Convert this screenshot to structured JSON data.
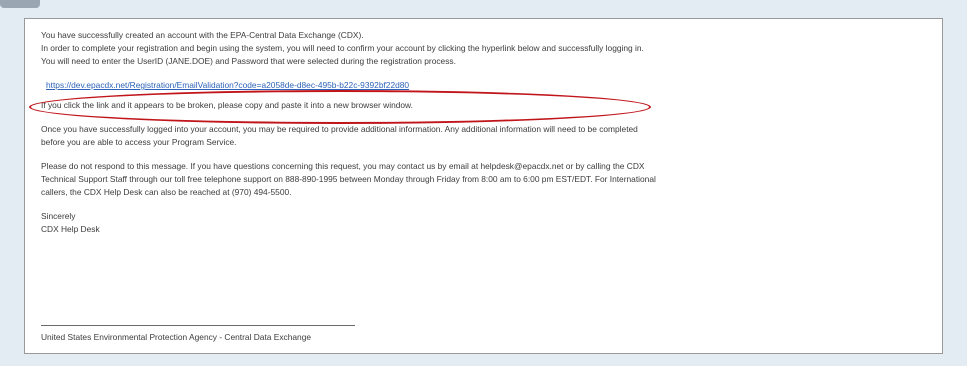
{
  "email": {
    "lines": [
      "You have successfully created an account with the EPA-Central Data Exchange (CDX).",
      "In order to complete your registration and begin using the system, you will need to confirm your account by clicking the hyperlink below and successfully logging in.",
      "You will need to enter the UserID (JANE.DOE) and Password that were selected during the registration process."
    ],
    "validation_link": "https://dev.epacdx.net/Registration/EmailValidation?code=a2058de-d8ec-495b-b22c-9392bf22d80",
    "broken_link_note": "If you click the link and it appears to be broken, please copy and paste it into a new browser window.",
    "additional_info": [
      "Once you have successfully logged into your account, you may be required to provide additional information. Any additional information will need to be completed",
      "before you are able to access your Program Service."
    ],
    "support": [
      "Please do not respond to this message. If you have questions concerning this request, you may contact us by email at helpdesk@epacdx.net or by calling the CDX",
      "Technical Support Staff through our toll free telephone support on 888-890-1995 between Monday through Friday from 8:00 am to 6:00 pm EST/EDT. For International",
      "callers, the CDX Help Desk can also be reached at (970) 494-5500."
    ],
    "closing": "Sincerely",
    "signature": "CDX Help Desk",
    "footer": "United States Environmental Protection Agency - Central Data Exchange"
  },
  "colors": {
    "background": "#e4ecf3",
    "link": "#2c63b8",
    "highlight": "#c0151b"
  }
}
